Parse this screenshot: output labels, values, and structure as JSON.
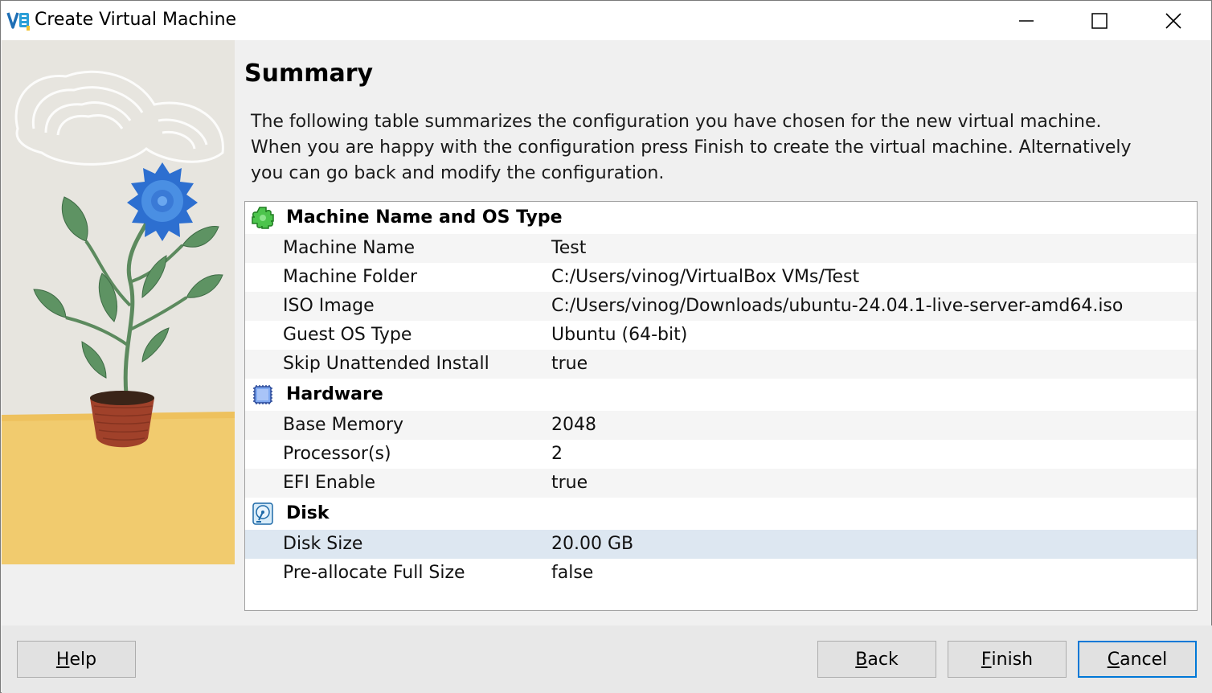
{
  "window": {
    "title": "Create Virtual Machine",
    "controls": [
      "minimize-icon",
      "maximize-icon",
      "close-icon"
    ]
  },
  "page": {
    "heading": "Summary",
    "description_lines": [
      "The following table summarizes the configuration you have chosen for the new virtual machine.",
      "When you are happy with the configuration press Finish to create the virtual machine. Alternatively",
      "you can go back and modify the configuration."
    ]
  },
  "summary": {
    "sections": [
      {
        "title": "Machine Name and OS Type",
        "icon": "puzzle-piece-icon",
        "rows": [
          {
            "key": "Machine Name",
            "value": "Test"
          },
          {
            "key": "Machine Folder",
            "value": "C:/Users/vinog/VirtualBox VMs/Test"
          },
          {
            "key": "ISO Image",
            "value": "C:/Users/vinog/Downloads/ubuntu-24.04.1-live-server-amd64.iso"
          },
          {
            "key": "Guest OS Type",
            "value": "Ubuntu (64-bit)"
          },
          {
            "key": "Skip Unattended Install",
            "value": "true"
          }
        ]
      },
      {
        "title": "Hardware",
        "icon": "chip-icon",
        "rows": [
          {
            "key": "Base Memory",
            "value": "2048"
          },
          {
            "key": "Processor(s)",
            "value": "2"
          },
          {
            "key": "EFI Enable",
            "value": "true"
          }
        ]
      },
      {
        "title": "Disk",
        "icon": "hard-disk-icon",
        "rows": [
          {
            "key": "Disk Size",
            "value": "20.00 GB",
            "selected": true
          },
          {
            "key": "Pre-allocate Full Size",
            "value": "false"
          }
        ]
      }
    ]
  },
  "buttons": {
    "help": {
      "accel": "H",
      "rest": "elp"
    },
    "back": {
      "accel": "B",
      "rest": "ack"
    },
    "finish": {
      "accel": "F",
      "rest": "inish"
    },
    "cancel": {
      "accel": "C",
      "rest": "ancel"
    }
  },
  "colors": {
    "selection": "#dde7f1",
    "default_button_border": "#0078d7",
    "floor_yellow": "#f1cb6e"
  }
}
